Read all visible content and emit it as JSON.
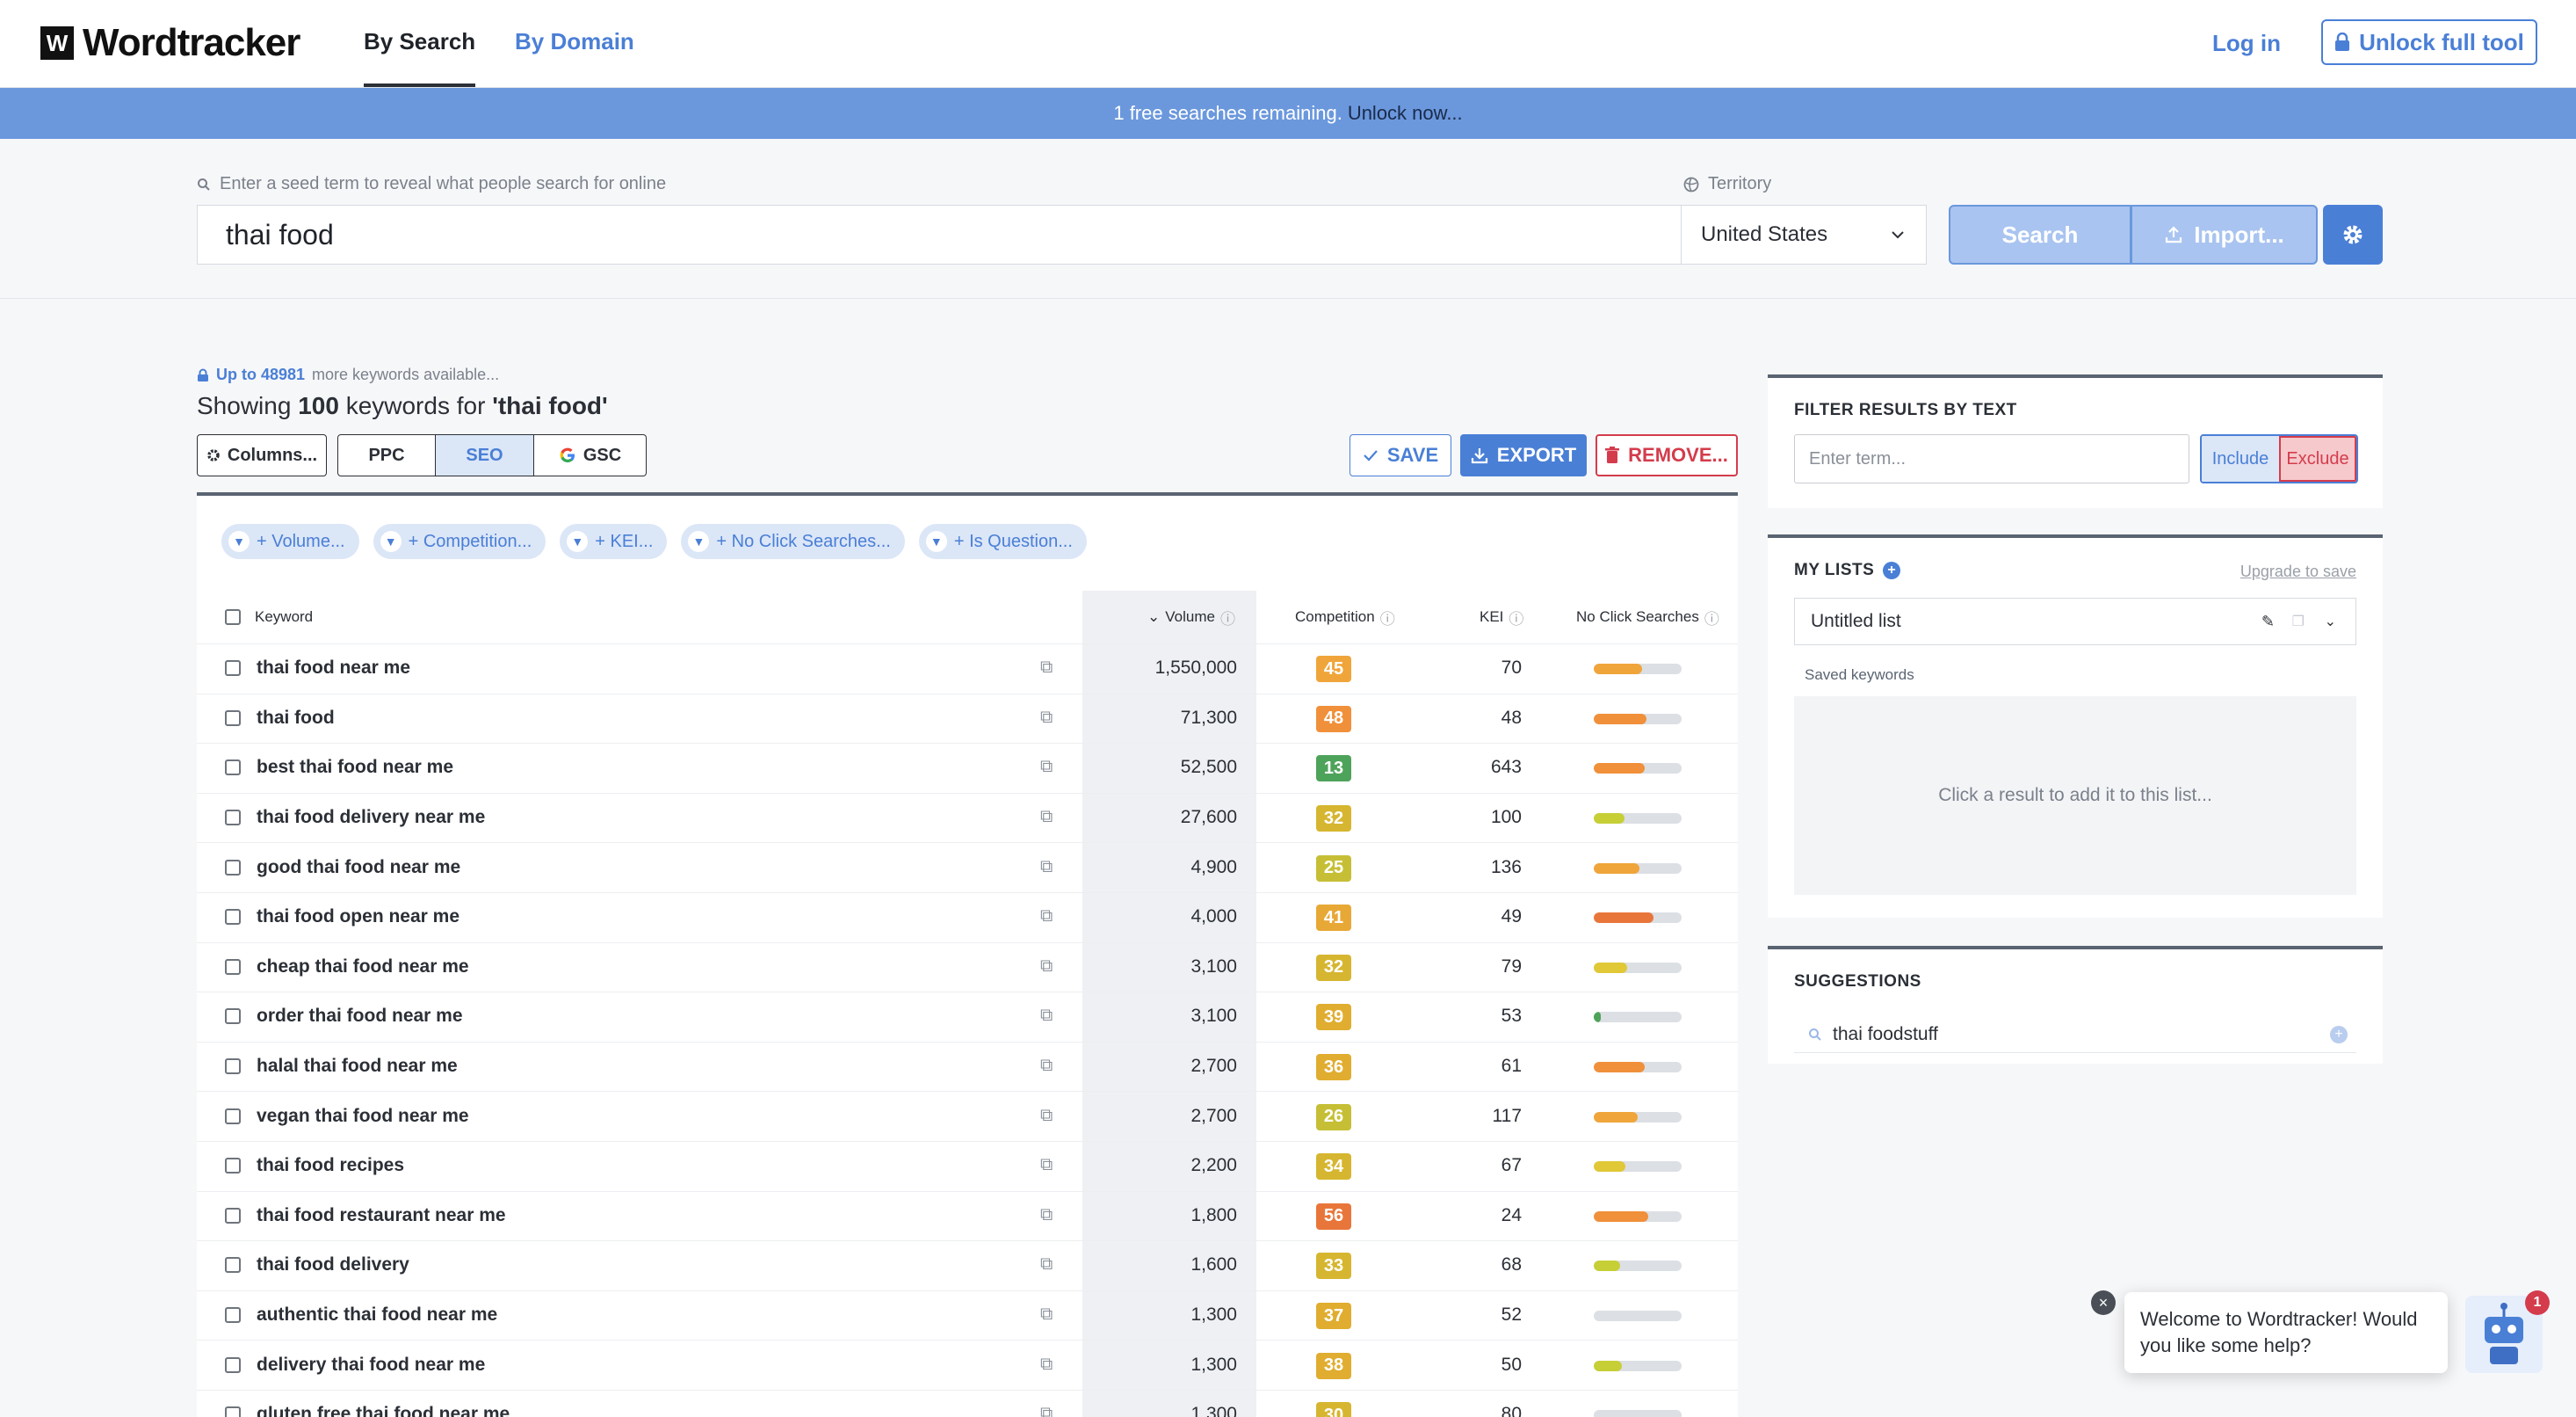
{
  "brand": {
    "logo_mark": "W",
    "name": "Wordtracker"
  },
  "nav": {
    "by_search": "By Search",
    "by_domain": "By Domain",
    "login": "Log in",
    "unlock": "Unlock full tool"
  },
  "banner": {
    "text": "1 free searches remaining.",
    "link": "Unlock now..."
  },
  "search": {
    "hint": "Enter a seed term to reveal what people search for online",
    "value": "thai food",
    "territory_label": "Territory",
    "territory_value": "United States",
    "search_button": "Search",
    "import_button": "Import..."
  },
  "results": {
    "more_count": "Up to 48981",
    "more_suffix": "more keywords available...",
    "showing_prefix": "Showing",
    "showing_count": "100",
    "showing_mid": "keywords for",
    "showing_term": "'thai food'"
  },
  "toolbar": {
    "columns": "Columns...",
    "ppc": "PPC",
    "seo": "SEO",
    "gsc": "GSC",
    "save": "SAVE",
    "export": "EXPORT",
    "remove": "REMOVE..."
  },
  "filters": [
    "+ Volume...",
    "+ Competition...",
    "+ KEI...",
    "+ No Click Searches...",
    "+ Is Question..."
  ],
  "columns": {
    "keyword": "Keyword",
    "volume": "Volume",
    "competition": "Competition",
    "kei": "KEI",
    "no_click": "No Click Searches"
  },
  "rows": [
    {
      "keyword": "thai food near me",
      "volume": "1,550,000",
      "competition": "45",
      "kei": "70",
      "ncs": 0.55,
      "ncs_color": "#f0a53a",
      "comp_color": "#f0a53a"
    },
    {
      "keyword": "thai food",
      "volume": "71,300",
      "competition": "48",
      "kei": "48",
      "ncs": 0.6,
      "ncs_color": "#f0903a",
      "comp_color": "#f0903a"
    },
    {
      "keyword": "best thai food near me",
      "volume": "52,500",
      "competition": "13",
      "kei": "643",
      "ncs": 0.58,
      "ncs_color": "#f0903a",
      "comp_color": "#4ea35a"
    },
    {
      "keyword": "thai food delivery near me",
      "volume": "27,600",
      "competition": "32",
      "kei": "100",
      "ncs": 0.35,
      "ncs_color": "#c6cf36",
      "comp_color": "#d6b630"
    },
    {
      "keyword": "good thai food near me",
      "volume": "4,900",
      "competition": "25",
      "kei": "136",
      "ncs": 0.52,
      "ncs_color": "#f0a53a",
      "comp_color": "#c6bf36"
    },
    {
      "keyword": "thai food open near me",
      "volume": "4,000",
      "competition": "41",
      "kei": "49",
      "ncs": 0.68,
      "ncs_color": "#e8763a",
      "comp_color": "#e8a836"
    },
    {
      "keyword": "cheap thai food near me",
      "volume": "3,100",
      "competition": "32",
      "kei": "79",
      "ncs": 0.38,
      "ncs_color": "#e0c836",
      "comp_color": "#d6b630"
    },
    {
      "keyword": "order thai food near me",
      "volume": "3,100",
      "competition": "39",
      "kei": "53",
      "ncs": 0.08,
      "ncs_color": "#4ea35a",
      "comp_color": "#e0ad30"
    },
    {
      "keyword": "halal thai food near me",
      "volume": "2,700",
      "competition": "36",
      "kei": "61",
      "ncs": 0.58,
      "ncs_color": "#f0903a",
      "comp_color": "#e0ad30"
    },
    {
      "keyword": "vegan thai food near me",
      "volume": "2,700",
      "competition": "26",
      "kei": "117",
      "ncs": 0.5,
      "ncs_color": "#f0a53a",
      "comp_color": "#c6bf36"
    },
    {
      "keyword": "thai food recipes",
      "volume": "2,200",
      "competition": "34",
      "kei": "67",
      "ncs": 0.36,
      "ncs_color": "#e0c836",
      "comp_color": "#d6b630"
    },
    {
      "keyword": "thai food restaurant near me",
      "volume": "1,800",
      "competition": "56",
      "kei": "24",
      "ncs": 0.62,
      "ncs_color": "#f0903a",
      "comp_color": "#e8763a"
    },
    {
      "keyword": "thai food delivery",
      "volume": "1,600",
      "competition": "33",
      "kei": "68",
      "ncs": 0.3,
      "ncs_color": "#c6cf36",
      "comp_color": "#d6b630"
    },
    {
      "keyword": "authentic thai food near me",
      "volume": "1,300",
      "competition": "37",
      "kei": "52",
      "ncs": 0.0,
      "ncs_color": "#dcdfe4",
      "comp_color": "#e0ad30"
    },
    {
      "keyword": "delivery thai food near me",
      "volume": "1,300",
      "competition": "38",
      "kei": "50",
      "ncs": 0.32,
      "ncs_color": "#c6cf36",
      "comp_color": "#e0ad30"
    },
    {
      "keyword": "gluten free thai food near me",
      "volume": "1,300",
      "competition": "30",
      "kei": "80",
      "ncs": 0.0,
      "ncs_color": "#dcdfe4",
      "comp_color": "#d6b630"
    }
  ],
  "filter_panel": {
    "title": "FILTER RESULTS BY TEXT",
    "placeholder": "Enter term...",
    "include": "Include",
    "exclude": "Exclude"
  },
  "lists_panel": {
    "title": "MY LISTS",
    "upgrade": "Upgrade to save",
    "list_name": "Untitled list",
    "saved_label": "Saved keywords",
    "empty_text": "Click a result to add it to this list..."
  },
  "suggestions": {
    "title": "SUGGESTIONS",
    "items": [
      "thai foodstuff"
    ]
  },
  "chat": {
    "message": "Welcome to Wordtracker! Would you like some help?",
    "badge": "1"
  },
  "colors": {
    "accent": "#4a7fd6",
    "banner": "#6b98dd",
    "danger": "#d43c4c"
  }
}
